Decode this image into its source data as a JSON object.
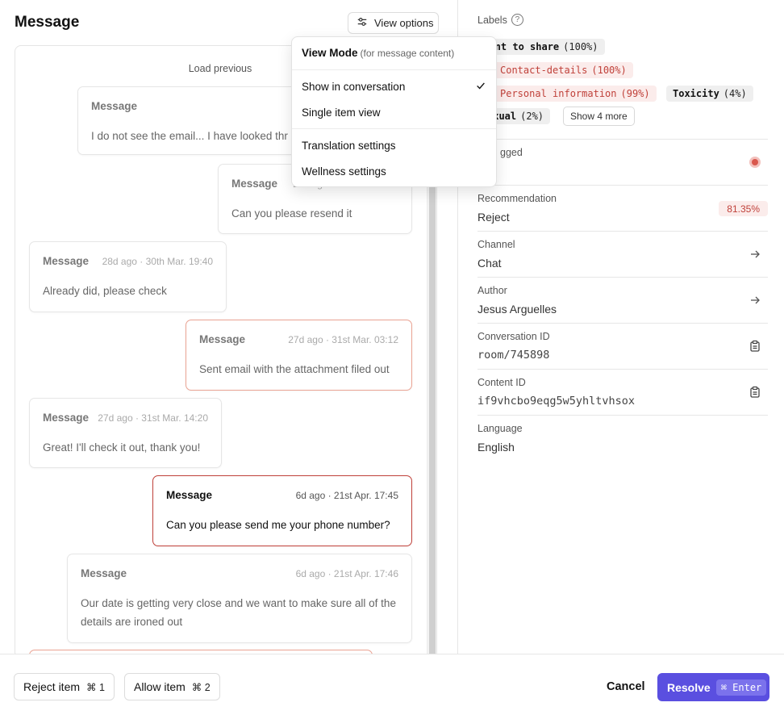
{
  "header": {
    "title": "Message",
    "view_options_label": "View options"
  },
  "conversation": {
    "load_previous": "Load previous",
    "messages": [
      {
        "label": "Message",
        "meta": "2",
        "body": "I do not see the email... I have looked thr"
      },
      {
        "label": "Message",
        "meta": "28d ago · 30th Mar. 19:3",
        "body": "Can you please resend it"
      },
      {
        "label": "Message",
        "meta": "28d ago · 30th Mar. 19:40",
        "body": "Already did, please check"
      },
      {
        "label": "Message",
        "meta": "27d ago · 31st Mar. 03:12",
        "body": "Sent email with the attachment filed out"
      },
      {
        "label": "Message",
        "meta": "27d ago · 31st Mar. 14:20",
        "body": "Great! I'll check it out, thank you!"
      },
      {
        "label": "Message",
        "meta": "6d ago · 21st Apr. 17:45",
        "body": "Can you please send me your phone number?"
      },
      {
        "label": "Message",
        "meta": "6d ago · 21st Apr. 17:46",
        "body": "Our date is getting very close and we want to make sure all of the details are ironed out"
      }
    ]
  },
  "view_menu": {
    "title": "View Mode",
    "subtitle": "(for message content)",
    "items": [
      {
        "label": "Show in conversation",
        "checked": true
      },
      {
        "label": "Single item view",
        "checked": false
      },
      {
        "label": "Translation settings"
      },
      {
        "label": "Wellness settings"
      }
    ]
  },
  "labels": {
    "title": "Labels",
    "help_icon": "?",
    "tags": [
      {
        "name": "ntent to share",
        "pct": "(100%)",
        "style": "gray"
      },
      {
        "name": "Contact-details",
        "pct": "(100%)",
        "style": "red"
      },
      {
        "name": "Personal information",
        "pct": "(99%)",
        "style": "red"
      },
      {
        "name": "Toxicity",
        "pct": "(4%)",
        "style": "gray"
      },
      {
        "name": "exual",
        "pct": "(2%)",
        "style": "gray"
      }
    ],
    "show_more": "Show 4 more"
  },
  "details": {
    "flagged_label": "gged",
    "recommendation_label": "Recommendation",
    "recommendation_value": "Reject",
    "recommendation_score": "81.35%",
    "channel_label": "Channel",
    "channel_value": "Chat",
    "author_label": "Author",
    "author_value": "Jesus Arguelles",
    "conversation_id_label": "Conversation ID",
    "conversation_id_value": "room/745898",
    "content_id_label": "Content ID",
    "content_id_value": "if9vhcbo9eqg5w5yhltvhsox",
    "language_label": "Language",
    "language_value": "English"
  },
  "footer": {
    "reject_label": "Reject item",
    "reject_kbd": "⌘ 1",
    "allow_label": "Allow item",
    "allow_kbd": "⌘ 2",
    "cancel_label": "Cancel",
    "resolve_label": "Resolve",
    "resolve_kbd": "⌘ Enter"
  },
  "colors": {
    "accent": "#5a4fe0",
    "flag_red": "#c0413a",
    "flag_light": "#fbeceb"
  }
}
